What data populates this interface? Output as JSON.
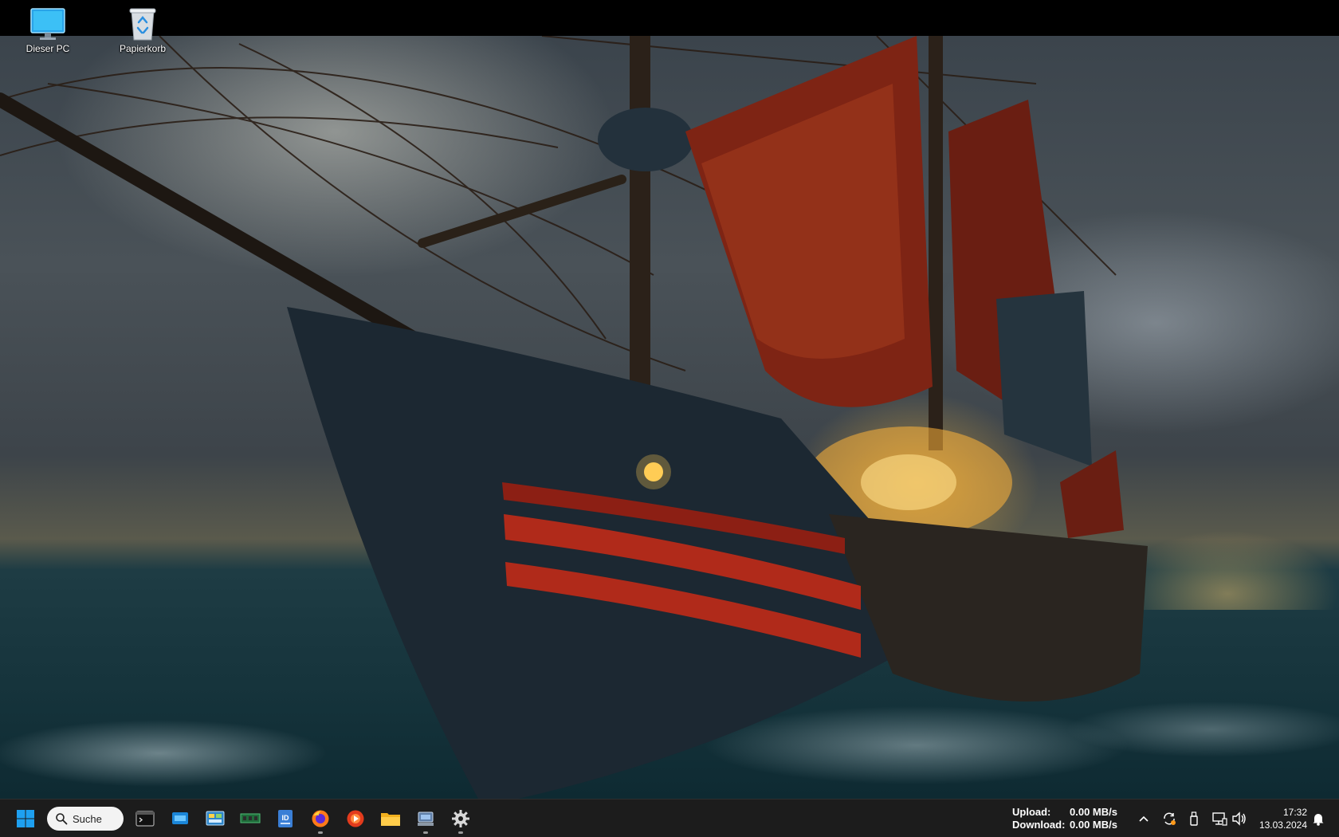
{
  "desktop": {
    "icons": [
      {
        "label": "Dieser PC",
        "icon": "monitor-icon"
      },
      {
        "label": "Papierkorb",
        "icon": "recycle-bin-icon"
      }
    ]
  },
  "taskbar": {
    "start_icon": "windows-start-icon",
    "search_label": "Suche",
    "apps": [
      {
        "name": "Terminal",
        "icon": "terminal-icon"
      },
      {
        "name": "Fenster",
        "icon": "window-app-icon"
      },
      {
        "name": "Systemsteuerung",
        "icon": "control-panel-icon"
      },
      {
        "name": "Speicher",
        "icon": "ram-module-icon"
      },
      {
        "name": "ID",
        "icon": "id-card-icon"
      },
      {
        "name": "Firefox",
        "icon": "firefox-icon"
      },
      {
        "name": "Media Player",
        "icon": "media-player-icon"
      },
      {
        "name": "Explorer",
        "icon": "file-explorer-icon"
      },
      {
        "name": "Server",
        "icon": "server-app-icon"
      },
      {
        "name": "Einstellungen",
        "icon": "settings-gear-icon"
      }
    ],
    "netspeed": {
      "upload_label": "Upload:",
      "upload_value": "0.00 MB/s",
      "download_label": "Download:",
      "download_value": "0.00 MB/s"
    },
    "tray": [
      "chevron-up-icon",
      "sync-icon",
      "usb-drive-icon",
      "network-icon",
      "volume-icon"
    ],
    "clock": {
      "time": "17:32",
      "date": "13.03.2024"
    },
    "notification_icon": "bell-icon"
  },
  "colors": {
    "taskbar_bg": "#1c1c1c",
    "accent": "#1e90ff"
  }
}
